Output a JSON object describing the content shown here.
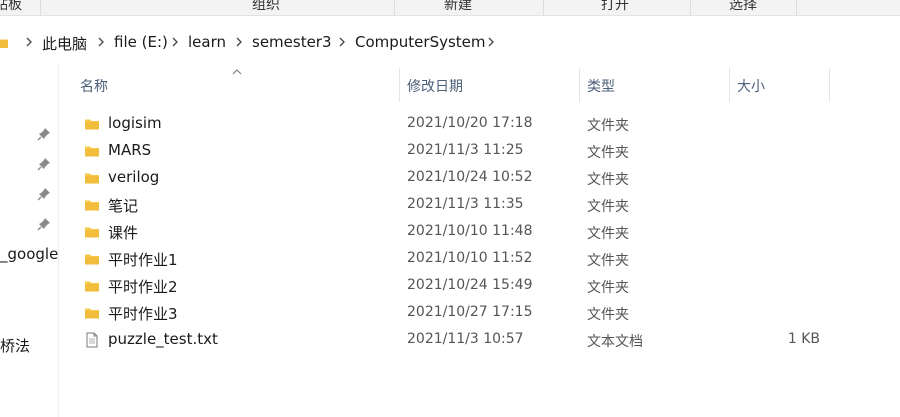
{
  "ribbon": {
    "groups": [
      "贴板",
      "组织",
      "新建",
      "打开",
      "选择"
    ]
  },
  "address": {
    "crumbs": [
      "此电脑",
      "file (E:)",
      "learn",
      "semester3",
      "ComputerSystem"
    ]
  },
  "nav": {
    "labels": [
      "_google",
      "桥法"
    ]
  },
  "columns": {
    "name": "名称",
    "date": "修改日期",
    "type": "类型",
    "size": "大小"
  },
  "files": [
    {
      "name": "logisim",
      "date": "2021/10/20 17:18",
      "type": "文件夹",
      "size": "",
      "icon": "folder-icon"
    },
    {
      "name": "MARS",
      "date": "2021/11/3 11:25",
      "type": "文件夹",
      "size": "",
      "icon": "folder-icon"
    },
    {
      "name": "verilog",
      "date": "2021/10/24 10:52",
      "type": "文件夹",
      "size": "",
      "icon": "folder-icon"
    },
    {
      "name": "笔记",
      "date": "2021/11/3 11:35",
      "type": "文件夹",
      "size": "",
      "icon": "folder-icon"
    },
    {
      "name": "课件",
      "date": "2021/10/10 11:48",
      "type": "文件夹",
      "size": "",
      "icon": "folder-icon"
    },
    {
      "name": "平时作业1",
      "date": "2021/10/10 11:52",
      "type": "文件夹",
      "size": "",
      "icon": "folder-icon"
    },
    {
      "name": "平时作业2",
      "date": "2021/10/24 15:49",
      "type": "文件夹",
      "size": "",
      "icon": "folder-icon"
    },
    {
      "name": "平时作业3",
      "date": "2021/10/27 17:15",
      "type": "文件夹",
      "size": "",
      "icon": "folder-icon"
    },
    {
      "name": "puzzle_test.txt",
      "date": "2021/11/3 10:57",
      "type": "文本文档",
      "size": "1 KB",
      "icon": "text-file-icon"
    }
  ],
  "colors": {
    "folder": "#f8c849",
    "folder_dark": "#e5a823",
    "header_text": "#4c607a"
  }
}
